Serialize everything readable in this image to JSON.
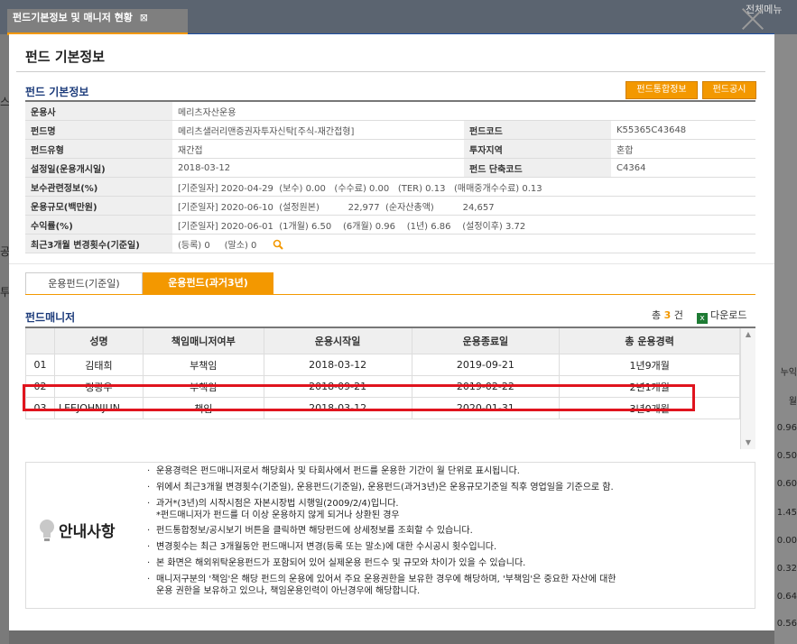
{
  "modal": {
    "tab_title": "펀드기본정보 및 매니저 현황",
    "tab_close": "⊠",
    "page_title": "펀드 기본정보"
  },
  "basic": {
    "section_title": "펀드 기본정보",
    "btn_integrated": "펀드통합정보",
    "btn_disclosure": "펀드공시",
    "rows": [
      {
        "label": "운용사",
        "value": "메리츠자산운용"
      },
      {
        "label": "펀드명",
        "value": "메리츠샐러리맨증권자투자신탁[주식-재간접형]",
        "label2": "펀드코드",
        "value2": "K55365C43648"
      },
      {
        "label": "펀드유형",
        "value": "재간접",
        "label2": "투자지역",
        "value2": "혼합"
      },
      {
        "label": "설정일(운용개시일)",
        "value": "2018-03-12",
        "label2": "펀드 단축코드",
        "value2": "C4364"
      },
      {
        "label": "보수관련정보(%)",
        "value": "[기준일자] 2020-04-29  (보수) 0.00   (수수료) 0.00   (TER) 0.13   (매매중개수수료) 0.13"
      },
      {
        "label": "운용규모(백만원)",
        "value": "[기준일자] 2020-06-10  (설정원본)          22,977  (순자산총액)          24,657"
      },
      {
        "label": "수익률(%)",
        "value": "[기준일자] 2020-06-01  (1개월) 6.50    (6개월) 0.96    (1년) 6.86    (설정이후) 3.72"
      },
      {
        "label": "최근3개월 변경횟수(기준일)",
        "value": "(등록) 0     (말소) 0"
      }
    ]
  },
  "tabs": [
    "운용펀드(기준일)",
    "운용펀드(과거3년)"
  ],
  "managers": {
    "section_title": "펀드매니저",
    "count_prefix": "총",
    "count": "3",
    "count_suffix": "건",
    "download": "다운로드",
    "headers": [
      "",
      "성명",
      "책임매니저여부",
      "운용시작일",
      "운용종료일",
      "총 운용경력"
    ],
    "rows": [
      [
        "01",
        "김태희",
        "부책임",
        "2018-03-12",
        "2019-09-21",
        "1년9개월"
      ],
      [
        "02",
        "정광우",
        "부책임",
        "2018-09-21",
        "2019-02-22",
        "2년1개월"
      ],
      [
        "03",
        "LEEJOHNJUN…",
        "책임",
        "2018-03-12",
        "2020-01-31",
        "3년0개월"
      ]
    ]
  },
  "notice": {
    "title": "안내사항",
    "items": [
      "운용경력은 펀드매니저로서 해당회사 및 타회사에서 펀드를 운용한 기간이 월 단위로 표시됩니다.",
      "위에서 최근3개월 변경횟수(기준일), 운용펀드(기준일), 운용펀드(과거3년)은 운용규모기준일 직후 영업일을 기준으로 함.",
      "과거*(3년)의 시작시점은 자본시장법 시행일(2009/2/4)입니다.",
      "*펀드매니저가 펀드를 더 이상 운용하지 않게 되거나 상환된 경우",
      "펀드통합정보/공시보기 버튼을 클릭하면 해당펀드에 상세정보를 조회할 수 있습니다.",
      "변경횟수는 최근 3개월동안 펀드매니저 변경(등록 또는 말소)에 대한 수시공시 횟수입니다.",
      "본 화면은 해외위탁운용펀드가 포함되어 있어 실제운용 펀드수 및 규모와 차이가 있을 수 있습니다.",
      "매니저구분의 '책임'은 해당 펀드의 운용에 있어서 주요 운용권한을 보유한 경우에 해당하며, '부책임'은 중요한 자산에 대한",
      "운용 권한을 보유하고 있으나, 책임운용인력이 아닌경우에 해당합니다."
    ]
  },
  "background": {
    "right_numbers": [
      "0.96",
      "0.50",
      "0.60",
      "1.45",
      "0.00",
      "0.32",
      "0.64",
      "0.56"
    ],
    "right_label": "누익",
    "right_label2": "월",
    "left_chars": [
      "스",
      "공",
      "투"
    ],
    "top_right": "전체메뉴"
  },
  "colors": {
    "accent": "#f39800",
    "navy": "#1d3c7b",
    "highlight": "#e0141e"
  }
}
